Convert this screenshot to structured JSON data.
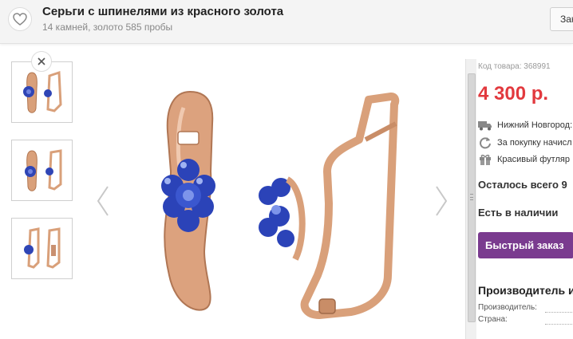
{
  "header": {
    "title": "Серьги с шпинелями из красного золота",
    "subtitle": "14 камней, золото 585 пробы",
    "close_label": "Закрыть"
  },
  "icons": {
    "favorite": "heart-icon",
    "thumb_close": "close-icon",
    "prev": "chevron-left-icon",
    "next": "chevron-right-icon",
    "delivery": "truck-icon",
    "bonus": "refresh-icon",
    "gift": "gift-icon"
  },
  "gallery": {
    "thumbnails": [
      "view-front-and-side",
      "view-front-and-side-alt",
      "view-side-and-back"
    ]
  },
  "product": {
    "sku": "Код товара: 368991",
    "price": "4 300 р.",
    "features": [
      "Нижний Новгород:",
      "За покупку начисл",
      "Красивый футляр"
    ],
    "remaining": "Осталось всего 9",
    "stock": "Есть в наличии",
    "buy_label": "Быстрый заказ"
  },
  "manufacturer": {
    "heading": "Производитель и",
    "rows": [
      "Производитель:",
      "Страна:"
    ]
  },
  "colors": {
    "price": "#e2393e",
    "buy_button": "#7a3b8f",
    "gold": "#d9a07a",
    "stone": "#2f45b5"
  }
}
